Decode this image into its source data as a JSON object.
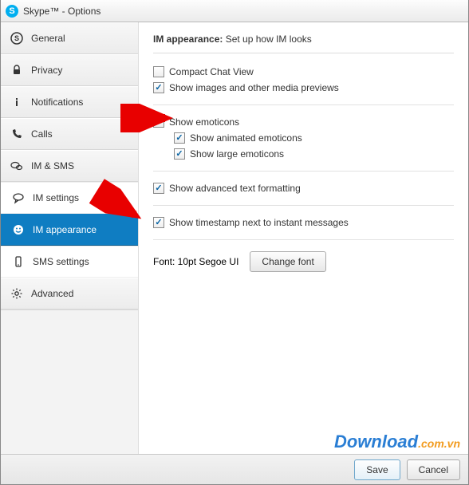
{
  "window": {
    "title": "Skype™ - Options"
  },
  "sidebar": {
    "items": [
      {
        "label": "General"
      },
      {
        "label": "Privacy"
      },
      {
        "label": "Notifications"
      },
      {
        "label": "Calls"
      },
      {
        "label": "IM & SMS"
      },
      {
        "label": "IM settings"
      },
      {
        "label": "IM appearance"
      },
      {
        "label": "SMS settings"
      },
      {
        "label": "Advanced"
      }
    ]
  },
  "content": {
    "heading_bold": "IM appearance:",
    "heading_rest": " Set up how IM looks",
    "compact": "Compact Chat View",
    "previews": "Show images and other media previews",
    "emoticons": "Show emoticons",
    "animated": "Show animated emoticons",
    "large": "Show large emoticons",
    "advanced_fmt": "Show advanced text formatting",
    "timestamp": "Show timestamp next to instant messages",
    "font_label": "Font: 10pt Segoe UI",
    "change_font": "Change font"
  },
  "footer": {
    "save": "Save",
    "cancel": "Cancel"
  },
  "watermark": {
    "d": "Download",
    "rest": ".com.vn"
  }
}
